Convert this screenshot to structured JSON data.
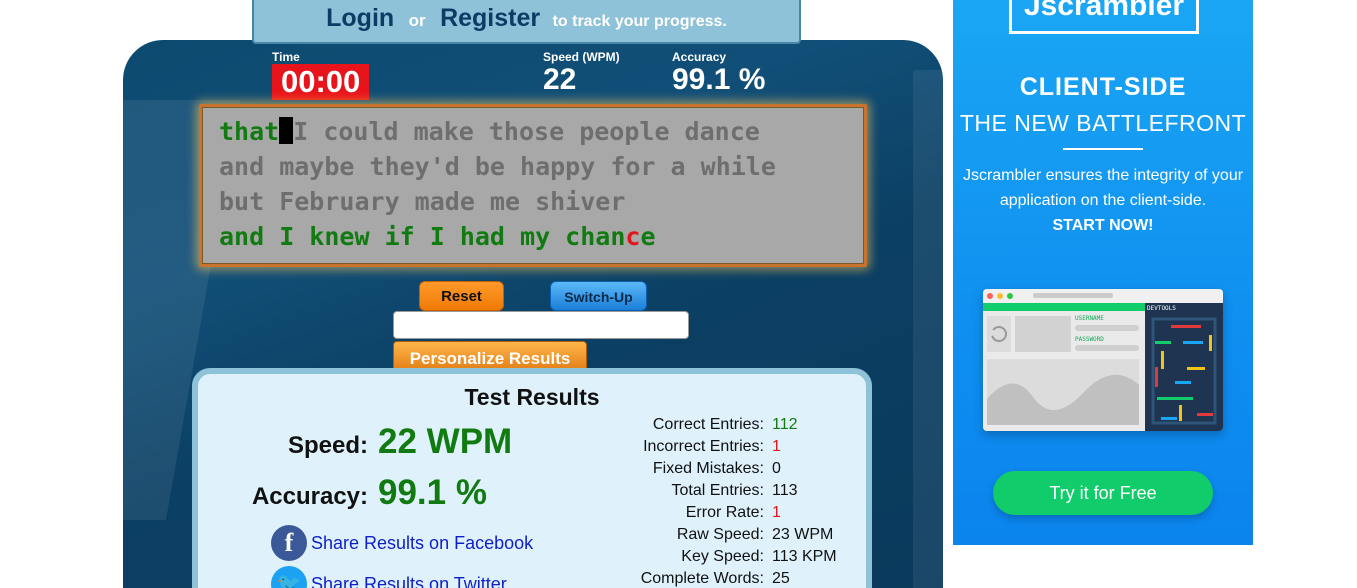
{
  "login_bar": {
    "login": "Login",
    "or": "or",
    "register": "Register",
    "suffix": "to track your progress."
  },
  "stats": {
    "time_label": "Time",
    "time_value": "00:00",
    "speed_label": "Speed (WPM)",
    "speed_value": "22",
    "accuracy_label": "Accuracy",
    "accuracy_value": "99.1 %"
  },
  "typing": {
    "line1_done": "that",
    "line1_rest": "I could make those people dance",
    "line2": "and maybe they'd be happy for a while",
    "line3": "but February made me shiver",
    "line4_done": "and I knew if I had my chan",
    "line4_err": "c",
    "line4_tail": "e"
  },
  "buttons": {
    "reset": "Reset",
    "switch_up": "Switch-Up",
    "personalize": "Personalize Results"
  },
  "input": {
    "value": ""
  },
  "results": {
    "title": "Test Results",
    "speed_label": "Speed:",
    "speed_value": "22 WPM",
    "accuracy_label": "Accuracy:",
    "accuracy_value": "99.1 %",
    "rows": [
      {
        "label": "Correct Entries:",
        "value": "112",
        "tone": "green"
      },
      {
        "label": "Incorrect Entries:",
        "value": "1",
        "tone": "red"
      },
      {
        "label": "Fixed Mistakes:",
        "value": "0",
        "tone": ""
      },
      {
        "label": "Total Entries:",
        "value": "113",
        "tone": ""
      },
      {
        "label": "Error Rate:",
        "value": "1",
        "tone": "red"
      },
      {
        "label": "Raw Speed:",
        "value": "23 WPM",
        "tone": ""
      },
      {
        "label": "Key Speed:",
        "value": "113 KPM",
        "tone": ""
      },
      {
        "label": "Complete Words:",
        "value": "25",
        "tone": ""
      }
    ],
    "share_facebook": "Share Results on Facebook",
    "share_twitter": "Share Results on Twitter"
  },
  "ad": {
    "brand": "Jscrambler",
    "headline": "CLIENT-SIDE",
    "subheadline": "THE NEW BATTLEFRONT",
    "body": "Jscrambler ensures the integrity of your application on the client-side.",
    "body_cta": "START NOW!",
    "mock_devtools": "DEVTOOLS",
    "mock_username": "USERNAME",
    "mock_password": "PASSWORD",
    "cta": "Try it for Free"
  },
  "colors": {
    "panel": "#0d4a70",
    "timer": "#e8141b",
    "correct": "#117a11",
    "error": "#e3141b",
    "ad_bg": "#1aa6f4",
    "ad_cta": "#11cc6a"
  }
}
